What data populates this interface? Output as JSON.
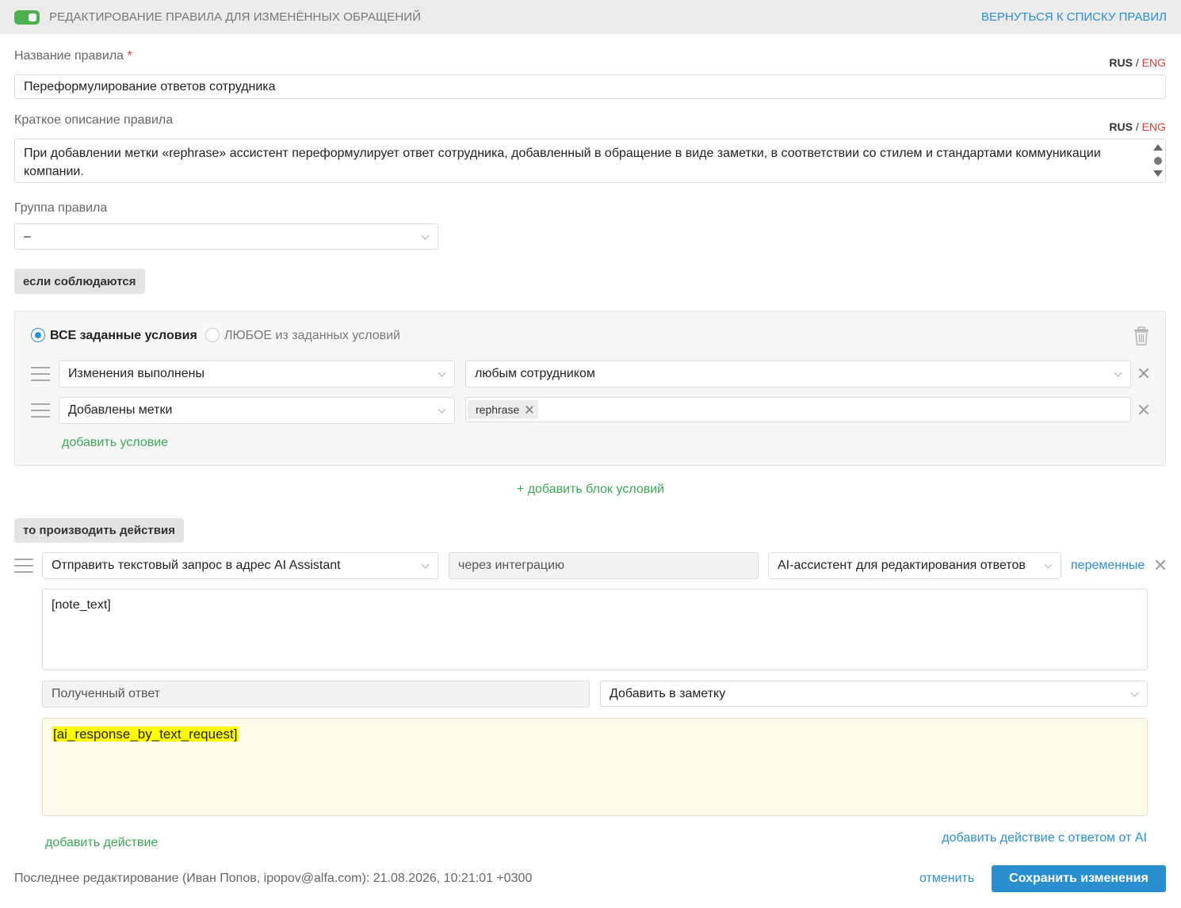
{
  "header": {
    "title": "РЕДАКТИРОВАНИЕ ПРАВИЛА ДЛЯ ИЗМЕНЁННЫХ ОБРАЩЕНИЙ",
    "back_link": "ВЕРНУТЬСЯ К СПИСКУ ПРАВИЛ",
    "toggle_on": true
  },
  "lang": {
    "rus": "RUS",
    "sep": "/",
    "eng": "ENG"
  },
  "rule_name": {
    "label": "Название правила",
    "required_mark": "*",
    "value": "Переформулирование ответов сотрудника"
  },
  "description": {
    "label": "Краткое описание правила",
    "value": "При добавлении метки «rephrase» ассистент переформулирует ответ сотрудника, добавленный в обращение в виде заметки, в соответствии со стилем и стандартами коммуникации компании."
  },
  "group": {
    "label": "Группа правила",
    "value": "–"
  },
  "conditions": {
    "section_label": "если соблюдаются",
    "mode_all": "ВСЕ заданные условия",
    "mode_any": "ЛЮБОЕ из заданных условий",
    "mode_selected": "all",
    "rows": [
      {
        "field": "Изменения выполнены",
        "value": "любым сотрудником"
      },
      {
        "field": "Добавлены метки",
        "tags": [
          "rephrase"
        ]
      }
    ],
    "add_condition": "добавить условие",
    "add_block": "+ добавить блок условий"
  },
  "actions": {
    "section_label": "то производить действия",
    "action": "Отправить текстовый запрос в адрес AI Assistant",
    "via": "через интеграцию",
    "assistant": "AI-ассистент для редактирования ответов",
    "variables_link": "переменные",
    "request_text": "[note_text]",
    "response_label": "Полученный ответ",
    "response_target": "Добавить в заметку",
    "response_text": "[ai_response_by_text_request]",
    "add_action": "добавить действие",
    "add_ai_action": "добавить действие с ответом от AI"
  },
  "footer": {
    "last_edit": "Последнее редактирование (Иван Попов, ipopov@alfa.com): 21.08.2026, 10:21:01 +0300",
    "cancel": "отменить",
    "save": "Сохранить изменения"
  }
}
